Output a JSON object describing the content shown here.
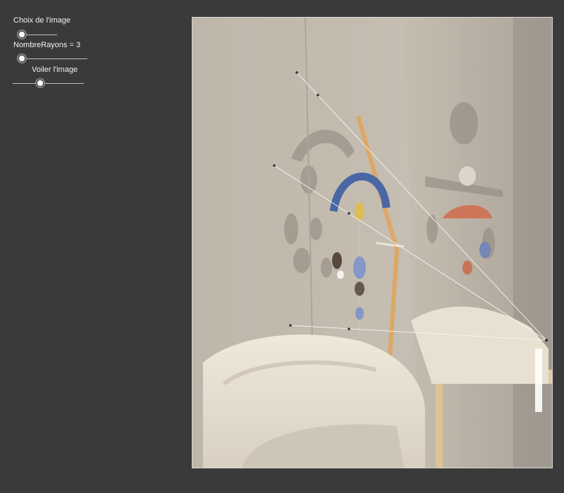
{
  "controls": {
    "image_choice_label": "Choix de l'image",
    "image_choice_value": 0,
    "ray_count_label": "NombreRayons = 3",
    "ray_count_value": 3,
    "veil_label": "Voiler l'image",
    "veil_value": 0.35
  },
  "scene": {
    "description_icon": "nursery-photo",
    "ray_color": "#f5f5f5",
    "background": "#3a3a3a"
  }
}
